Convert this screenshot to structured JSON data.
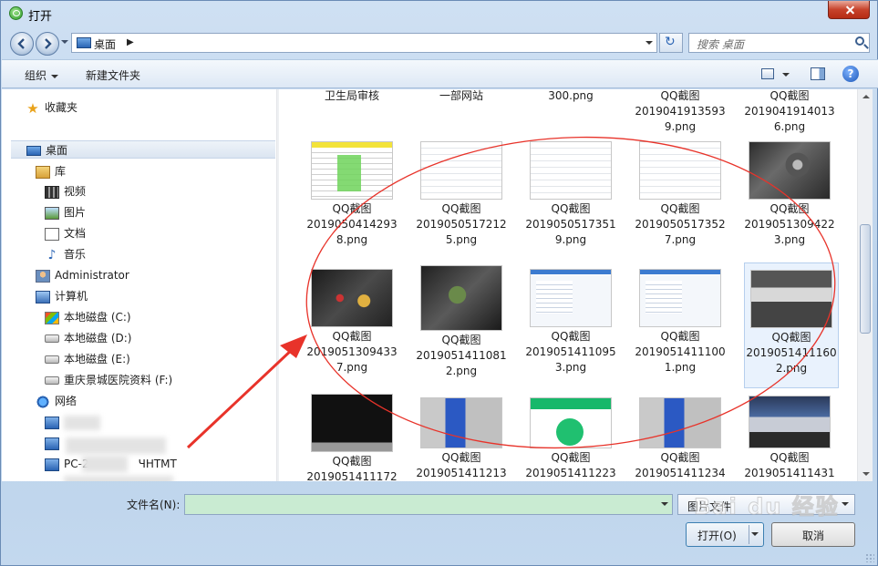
{
  "window": {
    "title": "打开"
  },
  "address": {
    "location": "桌面",
    "search_placeholder": "搜索 桌面"
  },
  "toolbar": {
    "organize": "组织",
    "new_folder": "新建文件夹"
  },
  "nav": {
    "favorites": "收藏夹",
    "desktop": "桌面",
    "libraries": "库",
    "videos": "视频",
    "pictures": "图片",
    "documents": "文档",
    "music": "音乐",
    "user": "Administrator",
    "computer": "计算机",
    "drive_c": "本地磁盘 (C:)",
    "drive_d": "本地磁盘 (D:)",
    "drive_e": "本地磁盘 (E:)",
    "drive_f": "重庆景城医院资料 (F:)",
    "network": "网络",
    "pc_partial_1": "PC-2",
    "pc_partial_1_tail": "ЧНТМТ"
  },
  "files": {
    "top_row": [
      "卫生局审核",
      "一部网站",
      "300.png",
      "QQ截图\n2019041913593\n9.png",
      "QQ截图\n2019041914013\n6.png"
    ],
    "rows": [
      [
        "QQ截图\n2019050414293\n8.png",
        "QQ截图\n2019050517212\n5.png",
        "QQ截图\n2019050517351\n9.png",
        "QQ截图\n2019050517352\n7.png",
        "QQ截图\n2019051309422\n3.png"
      ],
      [
        "QQ截图\n2019051309433\n7.png",
        "QQ截图\n2019051411081\n2.png",
        "QQ截图\n2019051411095\n3.png",
        "QQ截图\n2019051411100\n1.png",
        "QQ截图\n2019051411160\n2.png"
      ],
      [
        "QQ截图\n2019051411172",
        "QQ截图\n2019051411213",
        "QQ截图\n2019051411223",
        "QQ截图\n2019051411234",
        "QQ截图\n2019051411431"
      ]
    ]
  },
  "bottom": {
    "filename_label": "文件名(N):",
    "filename_value": "",
    "filter": "图片文件",
    "open": "打开(O)",
    "cancel": "取消"
  },
  "watermark": "Bai du 经验",
  "colors": {
    "annotation_red": "#e8332a",
    "selection_bg": "#e9f2fd",
    "filename_bg": "#c9ebd2"
  }
}
